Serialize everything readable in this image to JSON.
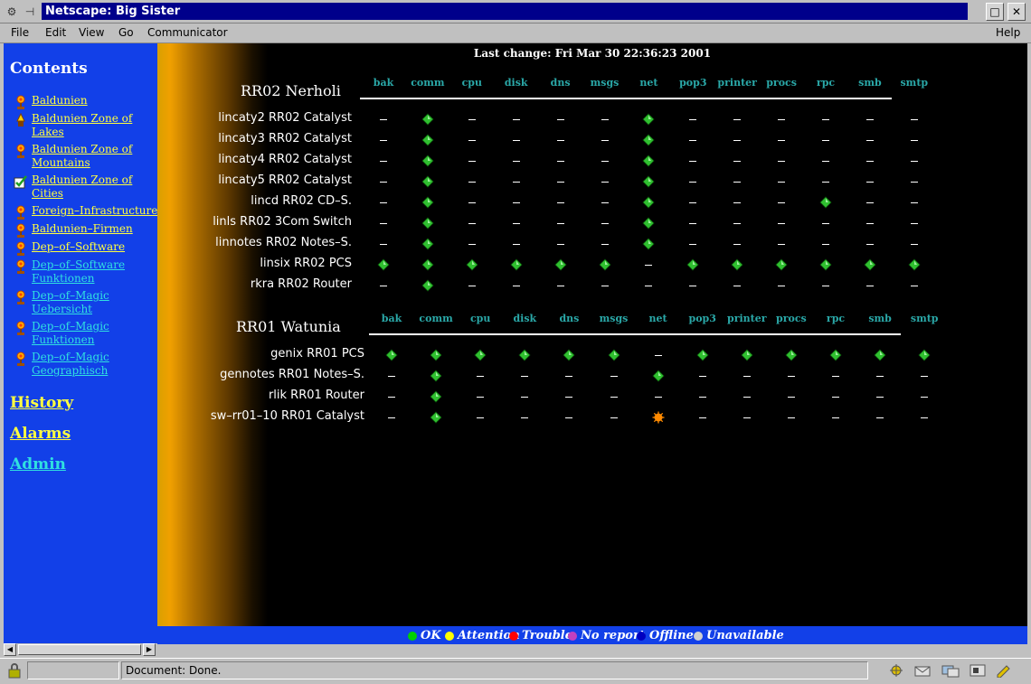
{
  "window": {
    "title": "Netscape: Big Sister",
    "min_glyph": "□",
    "close_glyph": "✕",
    "wm_menu_glyph": "⚙",
    "wm_pin_glyph": "⊣"
  },
  "menubar": {
    "file": "File",
    "edit": "Edit",
    "view": "View",
    "go": "Go",
    "communicator": "Communicator",
    "help": "Help"
  },
  "sidebar": {
    "heading": "Contents",
    "items": [
      {
        "label": "Baldunien",
        "icon": "status-flower-icon",
        "color": "yellow"
      },
      {
        "label": "Baldunien Zone of Lakes",
        "icon": "status-lamp-icon",
        "color": "yellow"
      },
      {
        "label": "Baldunien Zone of Mountains",
        "icon": "status-flower-icon",
        "color": "yellow"
      },
      {
        "label": "Baldunien Zone of Cities",
        "icon": "status-check-icon",
        "color": "yellow"
      },
      {
        "label": "Foreign–Infrastructure",
        "icon": "status-flower-icon",
        "color": "yellow"
      },
      {
        "label": "Baldunien–Firmen",
        "icon": "status-flower-icon",
        "color": "yellow"
      },
      {
        "label": "Dep–of–Software",
        "icon": "status-flower-icon",
        "color": "yellow"
      },
      {
        "label": "Dep–of–Software Funktionen",
        "icon": "status-flower-icon",
        "color": "teal"
      },
      {
        "label": "Dep–of–Magic Uebersicht",
        "icon": "status-flower-icon",
        "color": "teal"
      },
      {
        "label": "Dep–of–Magic Funktionen",
        "icon": "status-flower-icon",
        "color": "teal"
      },
      {
        "label": "Dep–of–Magic Geographisch",
        "icon": "status-flower-icon",
        "color": "teal"
      }
    ],
    "history": "History",
    "alarms": "Alarms",
    "admin": "Admin"
  },
  "main": {
    "last_change": "Last change: Fri Mar 30 22:36:23 2001",
    "columns": [
      "bak",
      "comm",
      "cpu",
      "disk",
      "dns",
      "msgs",
      "net",
      "pop3",
      "printer",
      "procs",
      "rpc",
      "smb",
      "smtp"
    ],
    "groups": [
      {
        "name": "RR02 Nerholi",
        "hosts": [
          {
            "name": "lincaty2 RR02 Catalyst",
            "status": [
              "-",
              "ok",
              "-",
              "-",
              "-",
              "-",
              "ok",
              "-",
              "-",
              "-",
              "-",
              "-",
              "-"
            ]
          },
          {
            "name": "lincaty3 RR02 Catalyst",
            "status": [
              "-",
              "ok",
              "-",
              "-",
              "-",
              "-",
              "ok",
              "-",
              "-",
              "-",
              "-",
              "-",
              "-"
            ]
          },
          {
            "name": "lincaty4 RR02 Catalyst",
            "status": [
              "-",
              "ok",
              "-",
              "-",
              "-",
              "-",
              "ok",
              "-",
              "-",
              "-",
              "-",
              "-",
              "-"
            ]
          },
          {
            "name": "lincaty5 RR02 Catalyst",
            "status": [
              "-",
              "ok",
              "-",
              "-",
              "-",
              "-",
              "ok",
              "-",
              "-",
              "-",
              "-",
              "-",
              "-"
            ]
          },
          {
            "name": "lincd RR02 CD–S.",
            "status": [
              "-",
              "ok",
              "-",
              "-",
              "-",
              "-",
              "ok",
              "-",
              "-",
              "-",
              "ok",
              "-",
              "-"
            ]
          },
          {
            "name": "linls RR02 3Com Switch",
            "status": [
              "-",
              "ok",
              "-",
              "-",
              "-",
              "-",
              "ok",
              "-",
              "-",
              "-",
              "-",
              "-",
              "-"
            ]
          },
          {
            "name": "linnotes RR02 Notes–S.",
            "status": [
              "-",
              "ok",
              "-",
              "-",
              "-",
              "-",
              "ok",
              "-",
              "-",
              "-",
              "-",
              "-",
              "-"
            ]
          },
          {
            "name": "linsix RR02 PCS",
            "status": [
              "ok",
              "ok",
              "ok",
              "ok",
              "ok",
              "ok",
              "-",
              "ok",
              "ok",
              "ok",
              "ok",
              "ok",
              "ok"
            ]
          },
          {
            "name": "rkra RR02 Router",
            "status": [
              "-",
              "ok",
              "-",
              "-",
              "-",
              "-",
              "-",
              "-",
              "-",
              "-",
              "-",
              "-",
              "-"
            ]
          }
        ]
      },
      {
        "name": "RR01 Watunia",
        "hosts": [
          {
            "name": "genix RR01 PCS",
            "status": [
              "ok",
              "ok",
              "ok",
              "ok",
              "ok",
              "ok",
              "-",
              "ok",
              "ok",
              "ok",
              "ok",
              "ok",
              "ok"
            ]
          },
          {
            "name": "gennotes RR01 Notes–S.",
            "status": [
              "-",
              "ok",
              "-",
              "-",
              "-",
              "-",
              "ok",
              "-",
              "-",
              "-",
              "-",
              "-",
              "-"
            ]
          },
          {
            "name": "rlik RR01 Router",
            "status": [
              "-",
              "ok",
              "-",
              "-",
              "-",
              "-",
              "-",
              "-",
              "-",
              "-",
              "-",
              "-",
              "-"
            ]
          },
          {
            "name": "sw–rr01–10 RR01 Catalyst",
            "status": [
              "-",
              "ok",
              "-",
              "-",
              "-",
              "-",
              "attention",
              "-",
              "-",
              "-",
              "-",
              "-",
              "-"
            ]
          }
        ]
      }
    ]
  },
  "legend": [
    {
      "label": "OK",
      "color": "#00d000"
    },
    {
      "label": "Attention",
      "color": "#ffff00"
    },
    {
      "label": "Trouble",
      "color": "#ff0000"
    },
    {
      "label": "No report",
      "color": "#c040c0"
    },
    {
      "label": "Offline",
      "color": "#0000c0"
    },
    {
      "label": "Unavailable",
      "color": "#d0d0d0"
    }
  ],
  "status_colors": {
    "ok": "#30c030",
    "attention": "#ff8a00"
  },
  "statusbar": {
    "text": "Document: Done."
  }
}
